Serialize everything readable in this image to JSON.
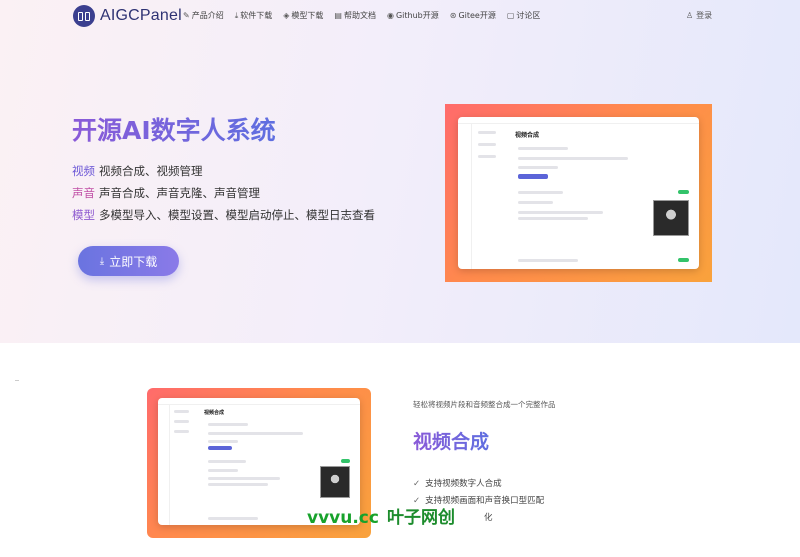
{
  "header": {
    "brand": "AIGCPanel",
    "menu": [
      {
        "icon": "pen-icon",
        "glyph": "✎",
        "label": "产品介绍"
      },
      {
        "icon": "download-icon",
        "glyph": "⤓",
        "label": "软件下载"
      },
      {
        "icon": "cube-icon",
        "glyph": "◈",
        "label": "模型下载"
      },
      {
        "icon": "book-icon",
        "glyph": "▤",
        "label": "帮助文档"
      },
      {
        "icon": "github-icon",
        "glyph": "◉",
        "label": "Github开源"
      },
      {
        "icon": "gitee-icon",
        "glyph": "⊛",
        "label": "Gitee开源"
      },
      {
        "icon": "chat-icon",
        "glyph": "▢",
        "label": "讨论区"
      }
    ],
    "login": {
      "icon": "user-icon",
      "glyph": "♙",
      "label": "登录"
    }
  },
  "hero": {
    "title": "开源AI数字人系统",
    "features": [
      {
        "key": "视频",
        "text": "视频合成、视频管理"
      },
      {
        "key": "声音",
        "text": "声音合成、声音克隆、声音管理"
      },
      {
        "key": "模型",
        "text": "多模型导入、模型设置、模型启动停止、模型日志查看"
      }
    ],
    "download_label": "立即下载"
  },
  "mockup": {
    "title": "视频合成"
  },
  "section2": {
    "subtitle": "轻松将视频片段和音频整合成一个完整作品",
    "title": "视频合成",
    "checks": [
      "支持视频数字人合成",
      "支持视频画面和声音换口型匹配",
      "化"
    ]
  },
  "watermark": {
    "part_a": "vvvu.cc",
    "part_b": "叶子网创"
  },
  "colors": {
    "accent": "#6a74e0",
    "brand": "#2e3273",
    "frame": "#ff8a4c"
  }
}
